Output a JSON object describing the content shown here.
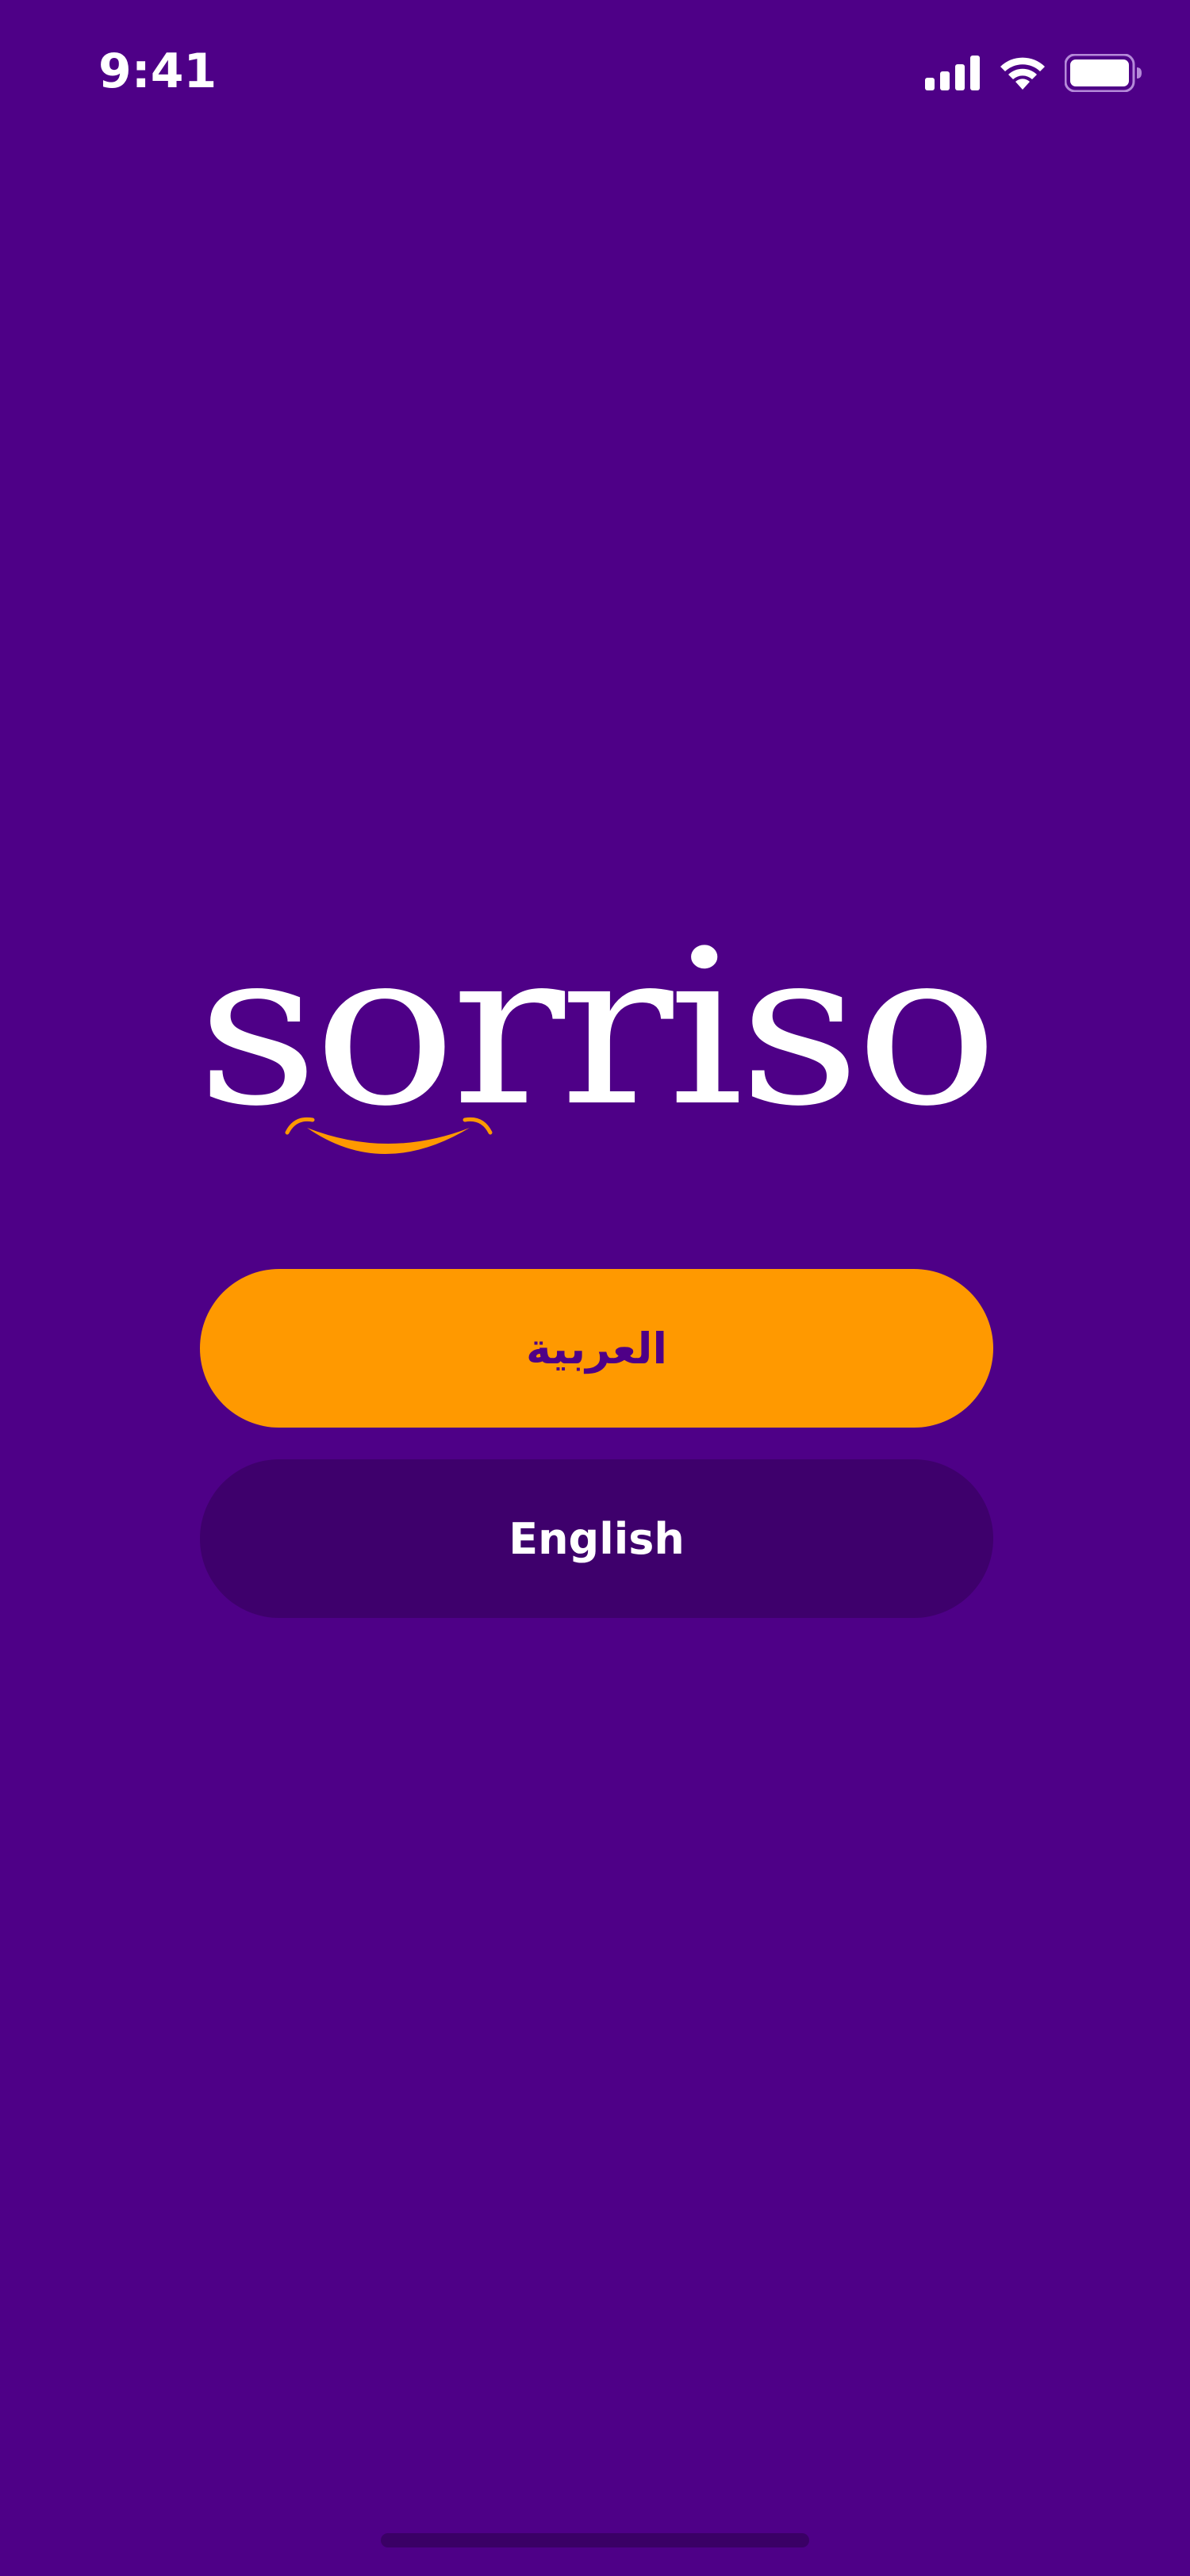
{
  "status_bar": {
    "time": "9:41",
    "signal_icon": "cellular-signal-icon",
    "wifi_icon": "wifi-icon",
    "battery_icon": "battery-icon"
  },
  "logo": {
    "text": "sorriso",
    "smile_icon": "smile-icon"
  },
  "language_buttons": {
    "arabic_label": "العربية",
    "english_label": "English"
  },
  "colors": {
    "background": "#4E0087",
    "accent": "#FF9900",
    "secondary_button": "#3E006C",
    "text_light": "#FFFFFF"
  }
}
